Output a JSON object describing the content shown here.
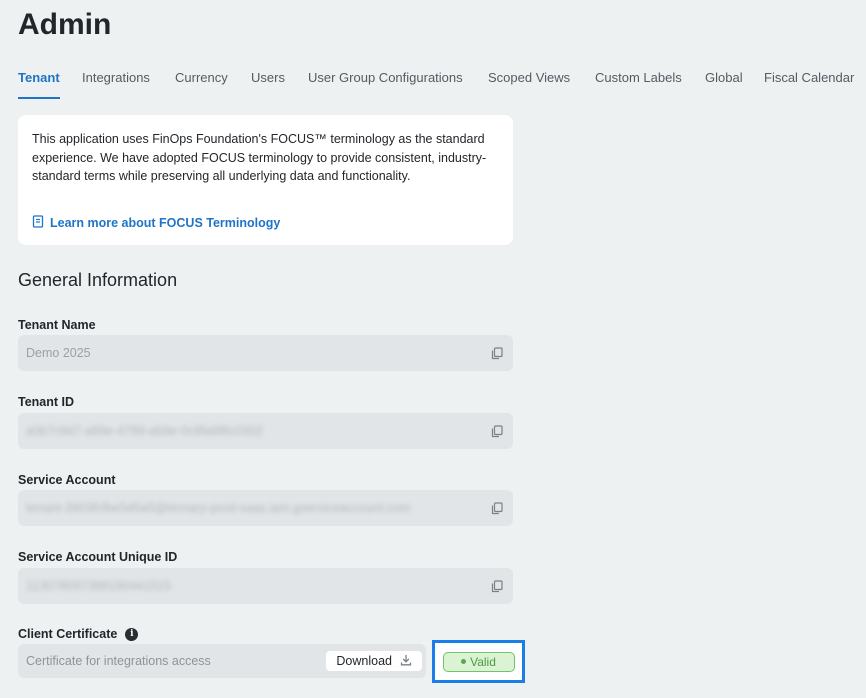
{
  "page": {
    "title": "Admin"
  },
  "tabs": [
    {
      "label": "Tenant",
      "active": true
    },
    {
      "label": "Integrations"
    },
    {
      "label": "Currency"
    },
    {
      "label": "Users"
    },
    {
      "label": "User Group Configurations"
    },
    {
      "label": "Scoped Views"
    },
    {
      "label": "Custom Labels"
    },
    {
      "label": "Global"
    },
    {
      "label": "Fiscal Calendar"
    }
  ],
  "focus_notice": {
    "text": "This application uses FinOps Foundation's FOCUS™ terminology as the standard experience. We have adopted FOCUS terminology to provide consistent, industry-standard terms while preserving all underlying data and functionality.",
    "link_label": "Learn more about FOCUS Terminology",
    "link_icon": "book-icon"
  },
  "general": {
    "title": "General Information",
    "fields": [
      {
        "label": "Tenant Name",
        "value": "Demo 2025",
        "blurred": false
      },
      {
        "label": "Tenant ID",
        "value": "a0b7c9d7-a89e-4789-ab9e-0c8fa6f8c0302",
        "blurred": true
      },
      {
        "label": "Service Account",
        "value": "tenant-3903fcfbe5d5a5@ternary-prod-saas.iam.gserviceaccount.com",
        "blurred": true
      },
      {
        "label": "Service Account Unique ID",
        "value": "113078097388190441515",
        "blurred": true
      }
    ],
    "certificate": {
      "label": "Client Certificate",
      "placeholder": "Certificate for integrations access",
      "download_label": "Download",
      "status": "Valid"
    }
  },
  "colors": {
    "accent": "#1f74c8",
    "valid_green": "#4f9a45",
    "highlight": "#1a7ee8"
  }
}
